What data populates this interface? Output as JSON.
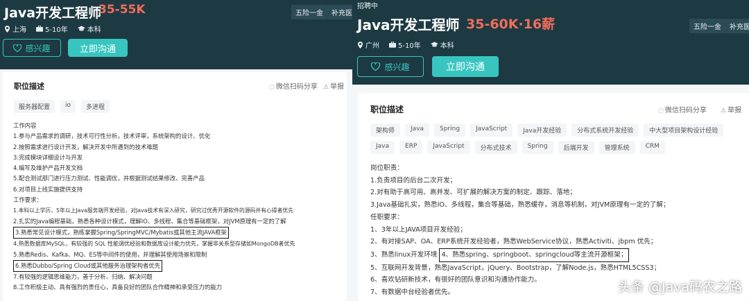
{
  "left": {
    "title": "Java开发工程师",
    "salary": "35-55K",
    "city": "上海",
    "experience": "5-10年",
    "degree": "本科",
    "benefits": [
      "五险一金",
      "补充医疗保"
    ],
    "interest_label": "感兴趣",
    "chat_label": "立即沟通",
    "section_title": "职位描述",
    "share_label": "微信扫码分享",
    "report_label": "举报",
    "tags": [
      "服务器配置",
      "io",
      "多进程"
    ],
    "lines": [
      "工作内容",
      "1.参与产品需求的调研，技术可行性分析，技术评审，系统架构的设计、优化",
      "2.按照需求进行设计开发，解决开发中所遇到的技术难题",
      "3.完成模块详细设计与开发",
      "4.编写及维护产品开发文档",
      "5.配合测试部门进行压力测试、性能调优，并根据测试结果修改、完善产品",
      "6.对项目上线实施提供支持",
      "工作要求：",
      "1.本科以上学历，5年以上Java服务端开发经验，对Java技术有深入研究，研究过优秀开源软件的源码并有心得者优先",
      "2.扎实的Java编程基础，熟悉各种设计模式，理解IO、多线程、集合等基础框架，对JVM原理有一定的了解",
      "3.熟悉常见设计模式，熟练掌握Spring/SpringMVC/Mybatis或其他主流JAVA框架",
      "4.熟悉数据库MySQL，有较强的 SQL 性能调优经验和数据库设计能力优先，掌握非关系型存储如MongoDB者优先",
      "5.熟悉Redis、Kafka、MQ、ES等中间件的使用，并理解其使用场景和限制",
      "6.熟悉Dubbo/Spring Cloud或其他服务治理架构者优先",
      "7.有较强的逻辑思维能力，善于分析、归纳、解决问题",
      "8.工作积极主动、具有强烈的责任心，具备良好的团队合作精神和承受压力的能力"
    ]
  },
  "right": {
    "status": "招聘中",
    "title": "Java开发工程师",
    "salary": "35-60K·16薪",
    "city": "广州",
    "experience": "5-10年",
    "degree": "本科",
    "benefits": [
      "五险一金",
      "补充医疗"
    ],
    "interest_label": "感兴趣",
    "chat_label": "立即沟通",
    "section_title": "职位描述",
    "share_label": "微信扫码分享",
    "report_label": "举报",
    "tags_row1": [
      "架构师",
      "Java",
      "Spring",
      "JavaScript",
      "Java开发经验",
      "分布式系统开发经验",
      "中大型项目架构设计经验"
    ],
    "tags_row2": [
      "Java",
      "ERP",
      "JavaScript",
      "分布式技术",
      "Spring",
      "后端开发",
      "管理系统",
      "CRM"
    ],
    "lines": [
      "岗位职责：",
      "1.负责项目的后台二次开发；",
      "2.对有助于高可用、高并发、可扩展的解决方案的制定、跟踪、落地；",
      "3.Java基础扎实，熟悉IO、多线程，集合等基础，熟悉缓存，消息等机制，对JVM原理有一定的了解；",
      "任职要求：",
      "1、3年以上JAVA项目开发经验；",
      "2、有对接SAP、OA、ERP系统开发经验者，熟悉WebService协议，熟悉Activiti、jbpm 优先；",
      "3、熟悉linux开发环境",
      "4、熟悉spring、springboot、springcloud等主流开源框架；",
      "5、互联网开发背景，熟悉JavaScript，jQuery、Bootstrap，了解Node.js，熟悉HTML5CSS3；",
      "6、喜欢钻研新技术，有很好的团队意识和沟通协作能力。",
      "7、有数据中台经验者优先。"
    ],
    "watermark": "头条 @Java码农之路"
  },
  "icons": {
    "location": "location-pin-icon",
    "experience": "briefcase-icon",
    "degree": "graduation-cap-icon",
    "heart": "heart-icon",
    "share": "qr-share-icon",
    "report": "warning-icon"
  },
  "colors": {
    "header_bg": "#1d3a43",
    "salary": "#f26d5b",
    "accent": "#38c5c0"
  }
}
